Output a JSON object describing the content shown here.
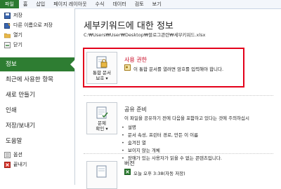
{
  "ribbon": {
    "file": "파일",
    "tabs": [
      "홈",
      "삽입",
      "페이지 레이아웃",
      "수식",
      "데이터",
      "검토",
      "보기"
    ]
  },
  "sidebar": {
    "commands": [
      {
        "label": "저장"
      },
      {
        "label": "다른 이름으로 저장"
      },
      {
        "label": "열기"
      },
      {
        "label": "닫기"
      }
    ],
    "tabs": [
      "정보",
      "최근에 사용한 항목",
      "새로 만들기",
      "인쇄",
      "저장/보내기",
      "도움말"
    ],
    "bottom": [
      {
        "label": "옵션"
      },
      {
        "label": "끝내기"
      }
    ]
  },
  "main": {
    "title": "세부키워드에 대한 정보",
    "path": "C:₩Users₩User₩Desktop₩블로그관련₩세부키워드.xlsx",
    "permissions": {
      "button_label_1": "통합 문서",
      "button_label_2": "보호 ▾",
      "title": "사용 권한",
      "desc": "이 통합 문서를 열려면 암호를 입력해야 합니다."
    },
    "prepare": {
      "button_label_1": "문제",
      "button_label_2": "확인 ▾",
      "title": "공유 준비",
      "desc": "이 파일을 공유하기 전에 다음을 포함하고 있다는 것에 주의하십시",
      "items": [
        "설명",
        "문서 속성, 프린터 경로, 만든 이 이름",
        "숨겨진 열",
        "보이지 않는 개체",
        "장애가 있는 사용자가 읽을 수 없는 콘텐츠입니다."
      ]
    },
    "versions": {
      "title": "버전",
      "entry": "오늘 오후 3:38(자동 저장)"
    }
  },
  "colors": {
    "accent": "#2e7d32",
    "highlight": "#e3001b",
    "permissions_title": "#c7001d"
  }
}
